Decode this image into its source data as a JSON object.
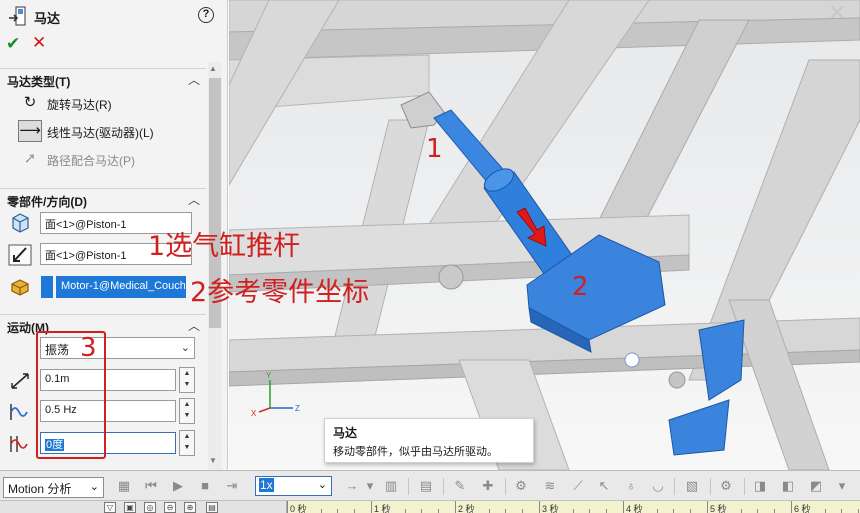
{
  "property_manager": {
    "title": "马达",
    "help_icon": "help-circle-icon",
    "ok_icon": "checkmark-icon",
    "cancel_icon": "close-x-icon",
    "motor_type": {
      "title": "马达类型(T)",
      "options": [
        {
          "label": "旋转马达(R)",
          "icon": "rotary-motor-icon",
          "selected": false,
          "enabled": true
        },
        {
          "label": "线性马达(驱动器)(L)",
          "icon": "linear-motor-icon",
          "selected": true,
          "enabled": true
        },
        {
          "label": "路径配合马达(P)",
          "icon": "path-mate-motor-icon",
          "selected": false,
          "enabled": false
        }
      ]
    },
    "component_direction": {
      "title": "零部件/方向(D)",
      "direction_face": "面<1>@Piston-1",
      "reference_face": "面<1>@Piston-1",
      "component": "Motor-1@Medical_Couch"
    },
    "motion": {
      "title": "运动(M)",
      "motion_type": "振荡",
      "displacement": "0.1m",
      "frequency": "0.5 Hz",
      "phase": "0度"
    }
  },
  "annotations": {
    "label_1": "1",
    "label_2": "2",
    "label_3": "3",
    "note_1": "1选气缸推杆",
    "note_2": "2参考零件坐标"
  },
  "tooltip": {
    "title": "马达",
    "body": "移动零部件，似乎由马达所驱动。"
  },
  "motion_manager": {
    "study_type": "Motion 分析",
    "playback_speed": "1x",
    "timeline_ticks": [
      "0 秒",
      "1 秒",
      "2 秒",
      "3 秒",
      "4 秒",
      "5 秒",
      "6 秒"
    ]
  },
  "colors": {
    "annotation_red": "#d02020",
    "piston_blue": "#2f7fdc",
    "frame_gray": "#d4d4d4",
    "selection_blue": "#1e78d7",
    "ok_green": "#1f8a1f",
    "cancel_red": "#d01818"
  }
}
